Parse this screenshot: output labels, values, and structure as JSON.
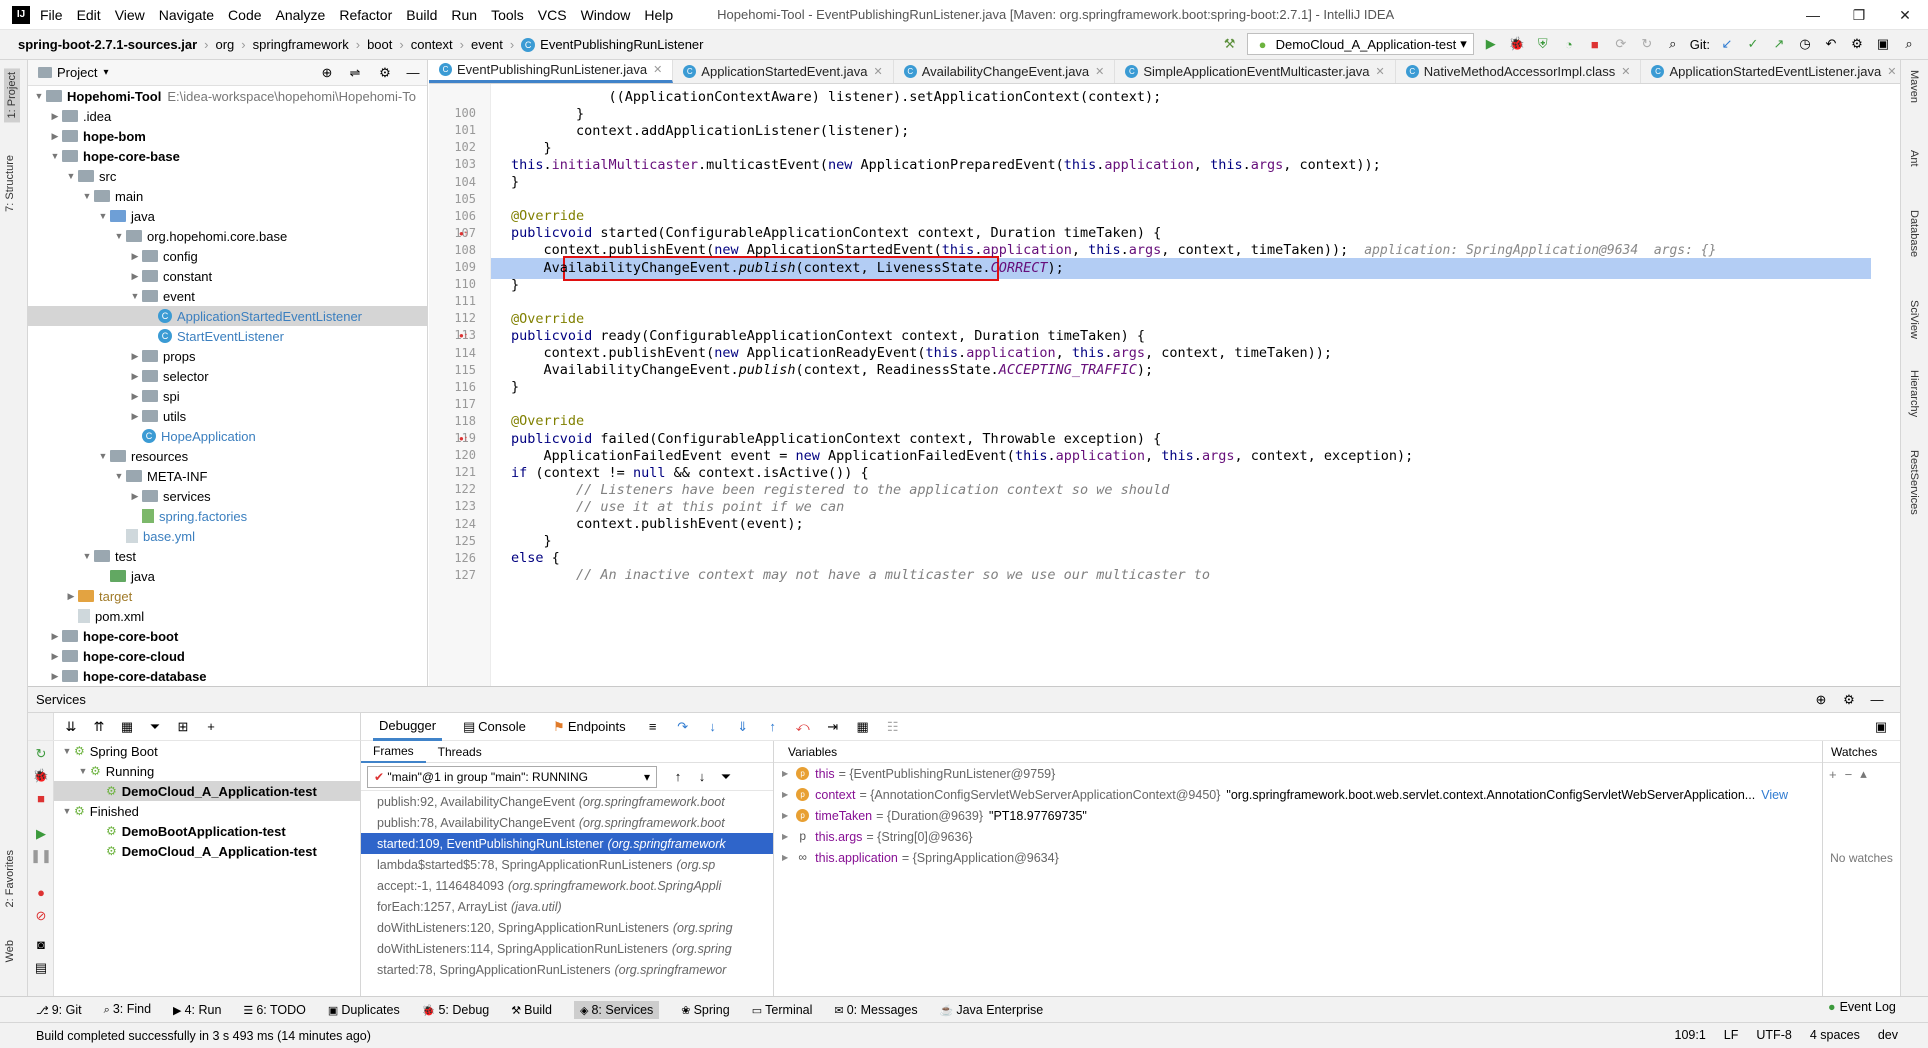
{
  "menu": [
    "File",
    "Edit",
    "View",
    "Navigate",
    "Code",
    "Analyze",
    "Refactor",
    "Build",
    "Run",
    "Tools",
    "VCS",
    "Window",
    "Help"
  ],
  "window_title": "Hopehomi-Tool - EventPublishingRunListener.java [Maven: org.springframework.boot:spring-boot:2.7.1] - IntelliJ IDEA",
  "breadcrumb": [
    "spring-boot-2.7.1-sources.jar",
    "org",
    "springframework",
    "boot",
    "context",
    "event",
    "EventPublishingRunListener"
  ],
  "run_config": "DemoCloud_A_Application-test",
  "git_label": "Git:",
  "project_panel": {
    "title": "Project"
  },
  "tree": [
    {
      "label": "Hopehomi-Tool",
      "extra": "E:\\idea-workspace\\hopehomi\\Hopehomi-To",
      "indent": 0,
      "icon": "folder",
      "bold": true,
      "arrow": "▼"
    },
    {
      "label": ".idea",
      "indent": 1,
      "icon": "folder",
      "arrow": "▶"
    },
    {
      "label": "hope-bom",
      "indent": 1,
      "icon": "folder",
      "bold": true,
      "arrow": "▶"
    },
    {
      "label": "hope-core-base",
      "indent": 1,
      "icon": "folder",
      "bold": true,
      "arrow": "▼"
    },
    {
      "label": "src",
      "indent": 2,
      "icon": "folder",
      "arrow": "▼"
    },
    {
      "label": "main",
      "indent": 3,
      "icon": "folder",
      "arrow": "▼"
    },
    {
      "label": "java",
      "indent": 4,
      "icon": "folder-blue",
      "arrow": "▼"
    },
    {
      "label": "org.hopehomi.core.base",
      "indent": 5,
      "icon": "folder",
      "arrow": "▼"
    },
    {
      "label": "config",
      "indent": 6,
      "icon": "folder",
      "arrow": "▶"
    },
    {
      "label": "constant",
      "indent": 6,
      "icon": "folder",
      "arrow": "▶"
    },
    {
      "label": "event",
      "indent": 6,
      "icon": "folder",
      "arrow": "▼"
    },
    {
      "label": "ApplicationStartedEventListener",
      "indent": 7,
      "icon": "class",
      "selected": true,
      "color": "#3b7fbf"
    },
    {
      "label": "StartEventListener",
      "indent": 7,
      "icon": "class",
      "color": "#3b7fbf"
    },
    {
      "label": "props",
      "indent": 6,
      "icon": "folder",
      "arrow": "▶"
    },
    {
      "label": "selector",
      "indent": 6,
      "icon": "folder",
      "arrow": "▶"
    },
    {
      "label": "spi",
      "indent": 6,
      "icon": "folder",
      "arrow": "▶"
    },
    {
      "label": "utils",
      "indent": 6,
      "icon": "folder",
      "arrow": "▶"
    },
    {
      "label": "HopeApplication",
      "indent": 6,
      "icon": "class",
      "color": "#3b7fbf"
    },
    {
      "label": "resources",
      "indent": 4,
      "icon": "folder",
      "arrow": "▼"
    },
    {
      "label": "META-INF",
      "indent": 5,
      "icon": "folder",
      "arrow": "▼"
    },
    {
      "label": "services",
      "indent": 6,
      "icon": "folder",
      "arrow": "▶"
    },
    {
      "label": "spring.factories",
      "indent": 6,
      "icon": "file-green",
      "color": "#3b7fbf"
    },
    {
      "label": "base.yml",
      "indent": 5,
      "icon": "file",
      "color": "#3b7fbf"
    },
    {
      "label": "test",
      "indent": 3,
      "icon": "folder",
      "arrow": "▼"
    },
    {
      "label": "java",
      "indent": 4,
      "icon": "folder-green"
    },
    {
      "label": "target",
      "indent": 2,
      "icon": "folder-orange",
      "arrow": "▶",
      "color": "#a07a28"
    },
    {
      "label": "pom.xml",
      "indent": 2,
      "icon": "file"
    },
    {
      "label": "hope-core-boot",
      "indent": 1,
      "icon": "folder",
      "bold": true,
      "arrow": "▶"
    },
    {
      "label": "hope-core-cloud",
      "indent": 1,
      "icon": "folder",
      "bold": true,
      "arrow": "▶"
    },
    {
      "label": "hope-core-database",
      "indent": 1,
      "icon": "folder",
      "bold": true,
      "arrow": "▶"
    }
  ],
  "editor_tabs": [
    {
      "label": "EventPublishingRunListener.java",
      "active": true
    },
    {
      "label": "ApplicationStartedEvent.java"
    },
    {
      "label": "AvailabilityChangeEvent.java"
    },
    {
      "label": "SimpleApplicationEventMulticaster.java"
    },
    {
      "label": "NativeMethodAccessorImpl.class"
    },
    {
      "label": "ApplicationStartedEventListener.java"
    }
  ],
  "code_lines": [
    {
      "n": "",
      "t": "            ((ApplicationContextAware) listener).setApplicationContext(context);"
    },
    {
      "n": "100",
      "t": "        }"
    },
    {
      "n": "101",
      "t": "        context.addApplicationListener(listener);"
    },
    {
      "n": "102",
      "t": "    }"
    },
    {
      "n": "103",
      "t": "    this.initialMulticaster.multicastEvent(new ApplicationPreparedEvent(this.application, this.args, context));"
    },
    {
      "n": "104",
      "t": "}"
    },
    {
      "n": "105",
      "t": ""
    },
    {
      "n": "106",
      "t": "@Override"
    },
    {
      "n": "107",
      "t": "public void started(ConfigurableApplicationContext context, Duration timeTaken) {"
    },
    {
      "n": "108",
      "t": "    context.publishEvent(new ApplicationStartedEvent(this.application, this.args, context, timeTaken));",
      "hint": "application: SpringApplication@9634  args: {}"
    },
    {
      "n": "109",
      "t": "    AvailabilityChangeEvent.publish(context, LivenessState.CORRECT);",
      "highlight": true
    },
    {
      "n": "110",
      "t": "}"
    },
    {
      "n": "111",
      "t": ""
    },
    {
      "n": "112",
      "t": "@Override"
    },
    {
      "n": "113",
      "t": "public void ready(ConfigurableApplicationContext context, Duration timeTaken) {"
    },
    {
      "n": "114",
      "t": "    context.publishEvent(new ApplicationReadyEvent(this.application, this.args, context, timeTaken));"
    },
    {
      "n": "115",
      "t": "    AvailabilityChangeEvent.publish(context, ReadinessState.ACCEPTING_TRAFFIC);"
    },
    {
      "n": "116",
      "t": "}"
    },
    {
      "n": "117",
      "t": ""
    },
    {
      "n": "118",
      "t": "@Override"
    },
    {
      "n": "119",
      "t": "public void failed(ConfigurableApplicationContext context, Throwable exception) {"
    },
    {
      "n": "120",
      "t": "    ApplicationFailedEvent event = new ApplicationFailedEvent(this.application, this.args, context, exception);"
    },
    {
      "n": "121",
      "t": "    if (context != null && context.isActive()) {"
    },
    {
      "n": "122",
      "t": "        // Listeners have been registered to the application context so we should",
      "comment": true
    },
    {
      "n": "123",
      "t": "        // use it at this point if we can",
      "comment": true
    },
    {
      "n": "124",
      "t": "        context.publishEvent(event);"
    },
    {
      "n": "125",
      "t": "    }"
    },
    {
      "n": "126",
      "t": "    else {"
    },
    {
      "n": "127",
      "t": "        // An inactive context may not have a multicaster so we use our multicaster to",
      "comment": true
    }
  ],
  "services": {
    "title": "Services",
    "tree": [
      {
        "label": "Spring Boot",
        "indent": 0,
        "arrow": "▼"
      },
      {
        "label": "Running",
        "indent": 1,
        "arrow": "▼"
      },
      {
        "label": "DemoCloud_A_Application-test",
        "indent": 2,
        "bold": true,
        "selected": true
      },
      {
        "label": "Finished",
        "indent": 0,
        "arrow": "▼"
      },
      {
        "label": "DemoBootApplication-test",
        "indent": 2,
        "bold": true
      },
      {
        "label": "DemoCloud_A_Application-test",
        "indent": 2,
        "bold": true
      }
    ]
  },
  "debugger": {
    "tabs": [
      "Debugger",
      "Console",
      "Endpoints"
    ],
    "frames_tabs": [
      "Frames",
      "Threads"
    ],
    "thread": "\"main\"@1 in group \"main\": RUNNING",
    "frames": [
      {
        "m": "publish:92, AvailabilityChangeEvent",
        "p": "(org.springframework.boot"
      },
      {
        "m": "publish:78, AvailabilityChangeEvent",
        "p": "(org.springframework.boot"
      },
      {
        "m": "started:109, EventPublishingRunListener",
        "p": "(org.springframework",
        "selected": true
      },
      {
        "m": "lambda$started$5:78, SpringApplicationRunListeners",
        "p": "(org.sp"
      },
      {
        "m": "accept:-1, 1146484093",
        "p": "(org.springframework.boot.SpringAppli"
      },
      {
        "m": "forEach:1257, ArrayList",
        "p": "(java.util)"
      },
      {
        "m": "doWithListeners:120, SpringApplicationRunListeners",
        "p": "(org.spring"
      },
      {
        "m": "doWithListeners:114, SpringApplicationRunListeners",
        "p": "(org.spring"
      },
      {
        "m": "started:78, SpringApplicationRunListeners",
        "p": "(org.springframewor"
      }
    ],
    "variables_title": "Variables",
    "variables": [
      {
        "name": "this",
        "type": "= {EventPublishingRunListener@9759}",
        "val": ""
      },
      {
        "name": "context",
        "type": "= {AnnotationConfigServletWebServerApplicationContext@9450}",
        "val": "\"org.springframework.boot.web.servlet.context.AnnotationConfigServletWebServerApplication...",
        "link": "View"
      },
      {
        "name": "timeTaken",
        "type": "= {Duration@9639}",
        "val": "\"PT18.97769735\""
      },
      {
        "name": "this.args",
        "type": "= {String[0]@9636}",
        "val": ""
      },
      {
        "name": "this.application",
        "type": "= {SpringApplication@9634}",
        "val": ""
      }
    ],
    "watches_title": "Watches",
    "no_watches": "No watches"
  },
  "bottom_tools": [
    "9: Git",
    "3: Find",
    "4: Run",
    "6: TODO",
    "Duplicates",
    "5: Debug",
    "Build",
    "8: Services",
    "Spring",
    "Terminal",
    "0: Messages",
    "Java Enterprise"
  ],
  "event_log": "Event Log",
  "status": {
    "message": "Build completed successfully in 3 s 493 ms (14 minutes ago)",
    "position": "109:1",
    "line_sep": "LF",
    "encoding": "UTF-8",
    "indent": "4 spaces",
    "branch": "dev"
  },
  "left_strip": [
    "1: Project",
    "7: Structure",
    "2: Favorites",
    "Web"
  ],
  "right_strip": [
    "Maven",
    "Ant",
    "Database",
    "SciView",
    "Hierarchy",
    "RestServices"
  ]
}
